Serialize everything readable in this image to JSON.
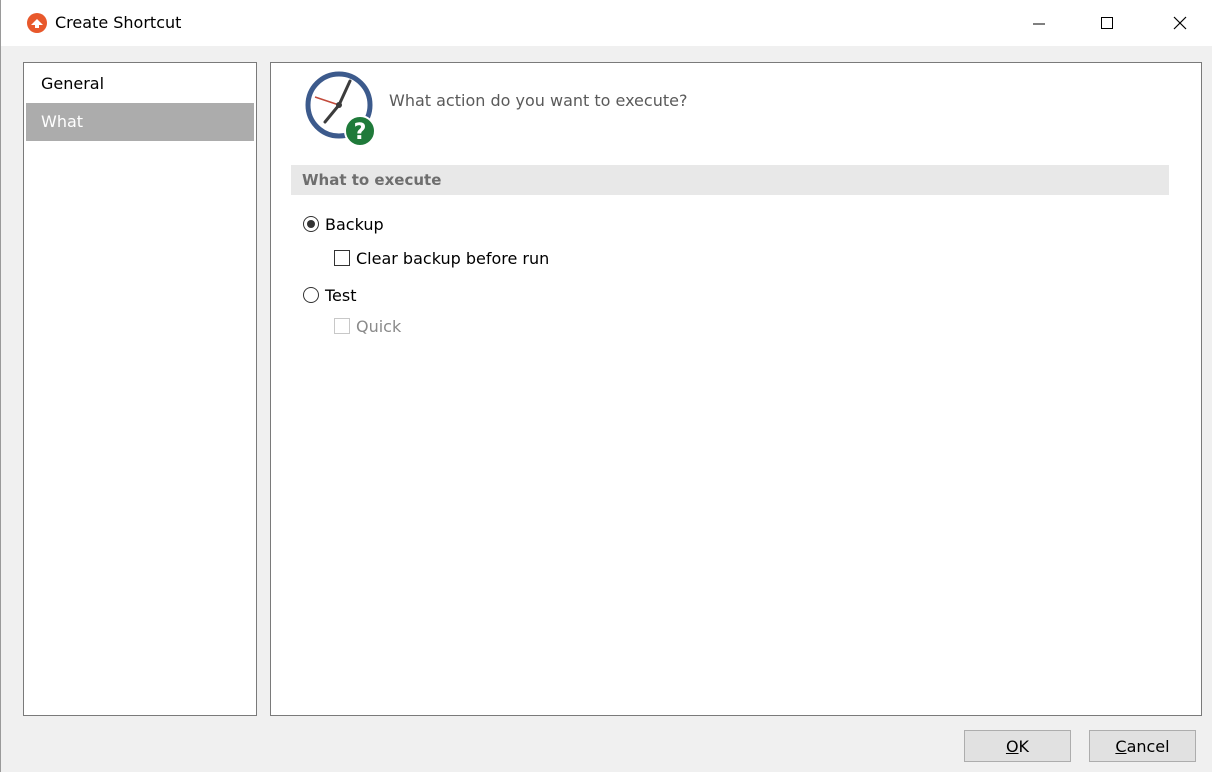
{
  "window": {
    "title": "Create Shortcut"
  },
  "nav": {
    "items": [
      {
        "label": "General",
        "selected": false
      },
      {
        "label": "What",
        "selected": true
      }
    ]
  },
  "panel": {
    "question": "What action do you want to execute?",
    "section_title": "What to execute",
    "options": {
      "backup": {
        "label": "Backup",
        "checked": true
      },
      "clear_backup": {
        "label": "Clear backup before run",
        "checked": false
      },
      "test": {
        "label": "Test",
        "checked": false
      },
      "quick": {
        "label": "Quick",
        "checked": false,
        "enabled": false
      }
    }
  },
  "buttons": {
    "ok": {
      "mnemonic": "O",
      "rest": "K"
    },
    "cancel": {
      "mnemonic": "C",
      "rest": "ancel"
    }
  },
  "colors": {
    "app_icon": "#e8582b",
    "clock_ring": "#3c5a8c",
    "help_badge": "#1f7a3a",
    "nav_selected": "#acacac"
  }
}
